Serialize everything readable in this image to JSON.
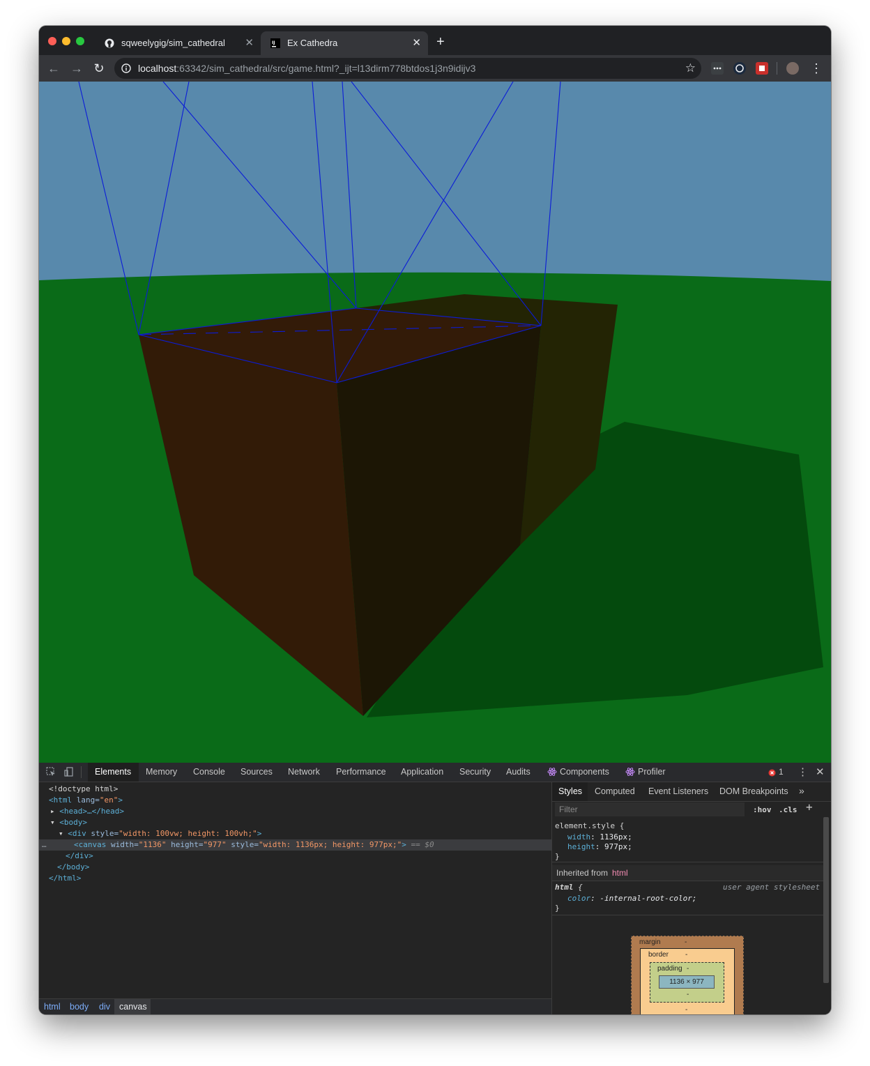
{
  "tabs": [
    {
      "title": "sqweelygig/sim_cathedral",
      "icon": "github-icon",
      "active": false
    },
    {
      "title": "Ex Cathedra",
      "icon": "intellij-icon",
      "active": true
    }
  ],
  "address_bar": {
    "host": "localhost",
    "rest": ":63342/sim_cathedral/src/game.html?_ijt=l13dirm778btdos1j3n9idijv3"
  },
  "devtools": {
    "tabs": [
      "Elements",
      "Memory",
      "Console",
      "Sources",
      "Network",
      "Performance",
      "Application",
      "Security",
      "Audits",
      "Components",
      "Profiler"
    ],
    "active_tab": "Elements",
    "error_count": "1",
    "dom": {
      "l1": "<!doctype html>",
      "l2_tag": "<html",
      "l2_attr": " lang=",
      "l2_val": "\"en\"",
      "l2_end": ">",
      "l3": "<head>…</head>",
      "l4": "<body>",
      "l5_tag": "<div",
      "l5_attr": " style=",
      "l5_val": "\"width: 100vw; height: 100vh;\"",
      "l5_end": ">",
      "l6_tag": "<canvas",
      "l6_a1": " width=",
      "l6_v1": "\"1136\"",
      "l6_a2": " height=",
      "l6_v2": "\"977\"",
      "l6_a3": " style=",
      "l6_v3": "\"width: 1136px; height: 977px;\"",
      "l6_end": ">",
      "l6_eq": " == $0",
      "l7": "</div>",
      "l8": "</body>",
      "l9": "</html>"
    },
    "breadcrumbs": [
      "html",
      "body",
      "div",
      "canvas"
    ],
    "styles_tabs": [
      "Styles",
      "Computed",
      "Event Listeners",
      "DOM Breakpoints"
    ],
    "filter_placeholder": "Filter",
    "hov": ":hov",
    "cls": ".cls",
    "element_style_selector": "element.style {",
    "element_style_rules": [
      {
        "prop": "width",
        "value": "1136px;"
      },
      {
        "prop": "height",
        "value": "977px;"
      }
    ],
    "close_brace": "}",
    "inherited_from_label": "Inherited from",
    "inherited_from_tag": "html",
    "html_rule_selector": "html",
    "html_rule_open": " {",
    "html_rule_source": "user agent stylesheet",
    "html_rule_prop": "color",
    "html_rule_value": "-internal-root-color;",
    "box_model": {
      "margin": "margin",
      "border": "border",
      "padding": "padding",
      "content": "1136 × 977",
      "dash": "-"
    }
  },
  "colors": {
    "sky": "#5889ac",
    "ground": "#0a6b18",
    "box_front_left": "#321b07",
    "box_front_right": "#1c1605",
    "box_top": "#331b08",
    "box_far": "#232404",
    "shadow": "#044a0d",
    "wire": "#0b1cd8"
  }
}
